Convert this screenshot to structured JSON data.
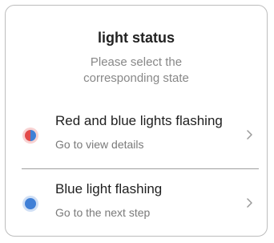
{
  "header": {
    "title": "light status",
    "subtitle_line1": "Please select the",
    "subtitle_line2": "corresponding state"
  },
  "options": [
    {
      "label": "Red and blue lights flashing",
      "sub": "Go to view details",
      "indicator": "red-blue-dot",
      "colors": [
        "#e24a4a",
        "#3f7fd6"
      ]
    },
    {
      "label": "Blue light flashing",
      "sub": "Go to the next step",
      "indicator": "blue-dot",
      "colors": [
        "#3f7fd6"
      ]
    }
  ],
  "icons": {
    "option_chevron": "chevron-right-icon"
  }
}
